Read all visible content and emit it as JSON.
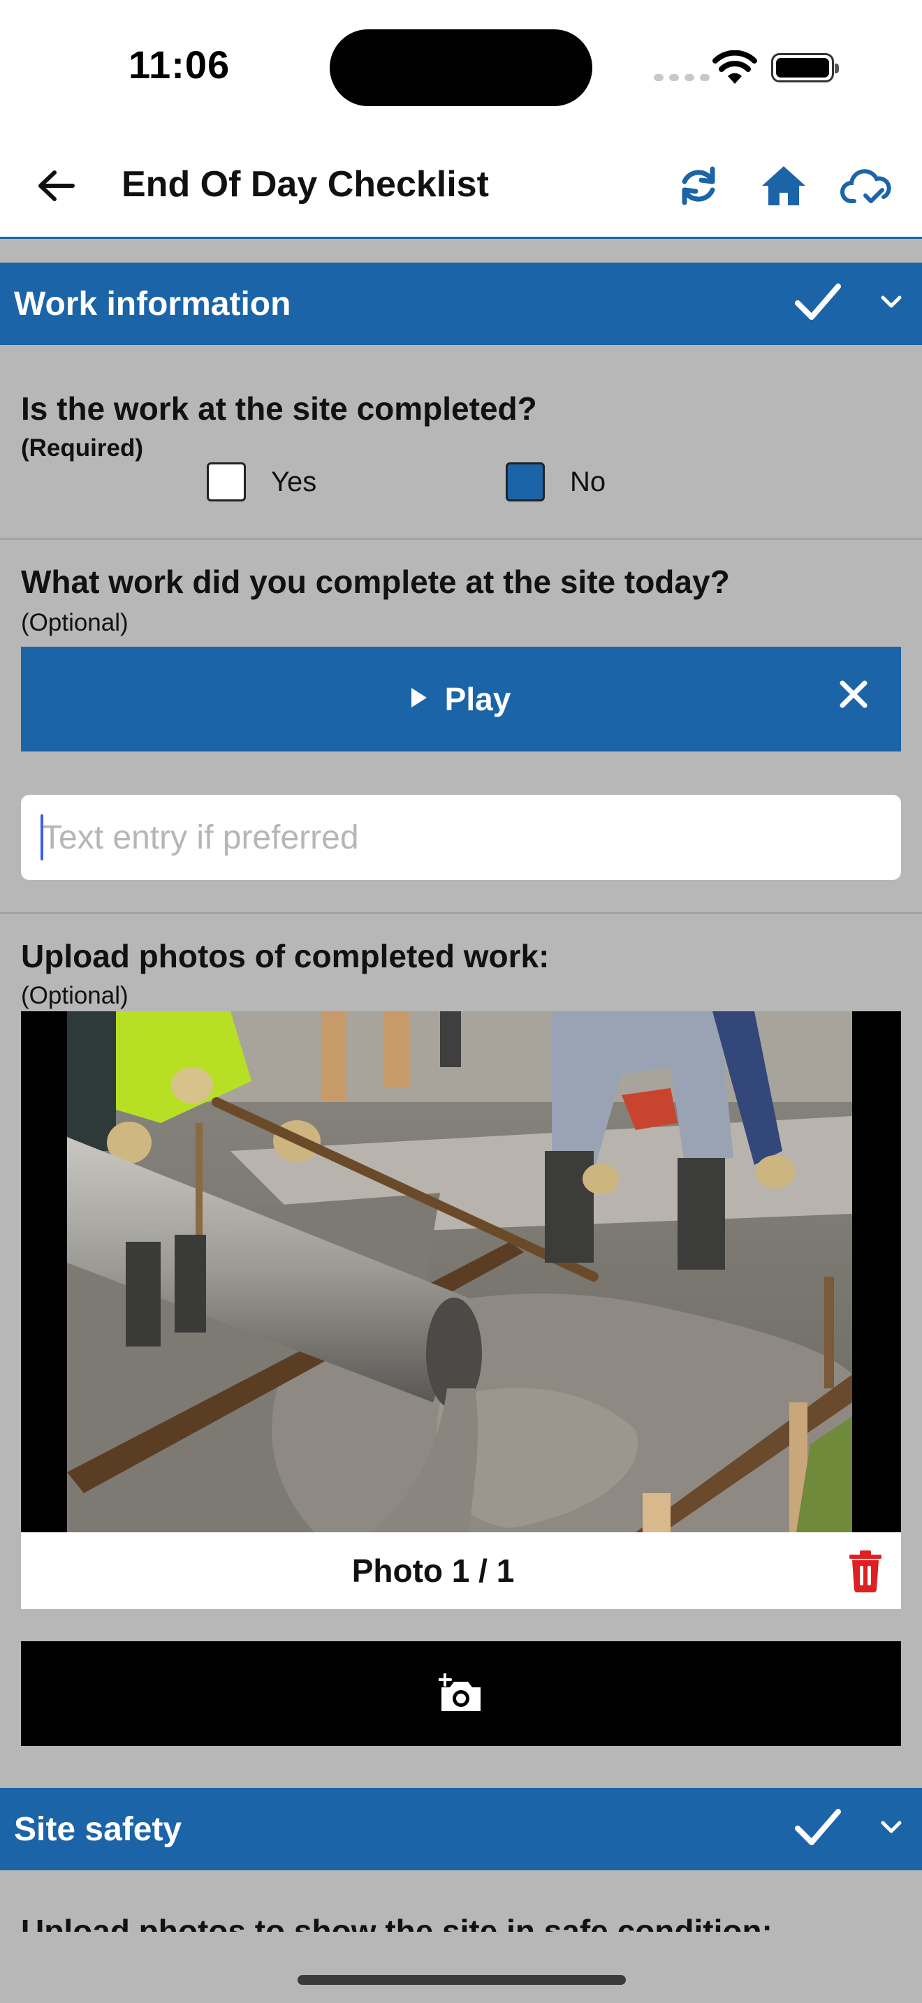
{
  "status_bar": {
    "time": "11:06"
  },
  "app_bar": {
    "title": "End Of Day Checklist",
    "icons": [
      "back-arrow-icon",
      "sync-icon",
      "home-icon",
      "cloud-check-icon"
    ],
    "accent_color": "#1c64a8"
  },
  "sections": {
    "work_information": {
      "title": "Work information",
      "completed": true
    },
    "site_safety": {
      "title": "Site safety",
      "completed": true
    }
  },
  "questions": {
    "site_completed": {
      "title": "Is the work at the site completed?",
      "requirement": "(Required)",
      "options": [
        {
          "label": "Yes",
          "checked": false
        },
        {
          "label": "No",
          "checked": true
        }
      ]
    },
    "work_completed_today": {
      "title": "What work did you complete at the site today?",
      "requirement": "(Optional)",
      "play_label": "Play",
      "text_value": "",
      "text_placeholder": "Text entry if preferred"
    },
    "upload_photos": {
      "title": "Upload photos of completed work:",
      "requirement": "(Optional)",
      "photo_counter": "Photo 1 / 1"
    },
    "safety_photos": {
      "title": "Upload photos to show the site in safe condition:"
    }
  }
}
